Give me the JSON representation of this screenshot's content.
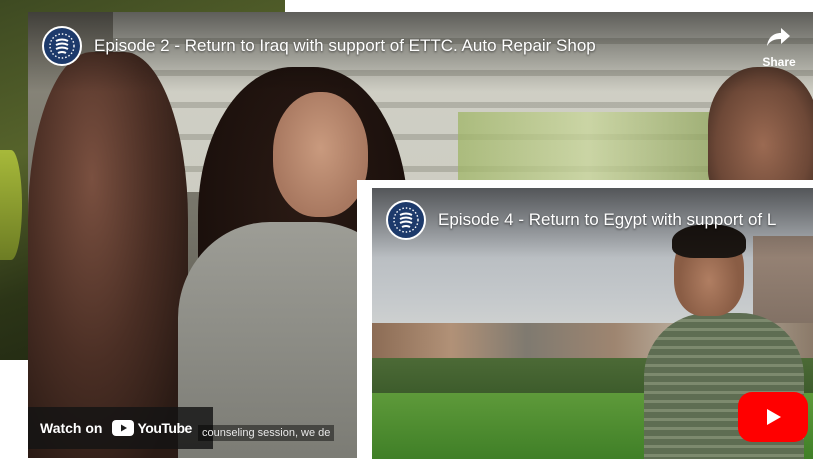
{
  "video_1": {
    "title": "Episode 2 - Return to Iraq with support of ETTC. Auto Repair Shop",
    "share_label": "Share",
    "watch_label": "Watch on",
    "youtube_label": "YouTube",
    "caption": "counseling session, we de"
  },
  "video_2": {
    "title": "Episode 4 - Return to Egypt with support of L"
  },
  "icons": {
    "channel": "channel-logo-icon",
    "share": "share-arrow-icon",
    "youtube": "youtube-logo-icon",
    "play": "play-icon"
  },
  "colors": {
    "youtube_red": "#ff0000",
    "channel_blue": "#1d3a6b"
  }
}
